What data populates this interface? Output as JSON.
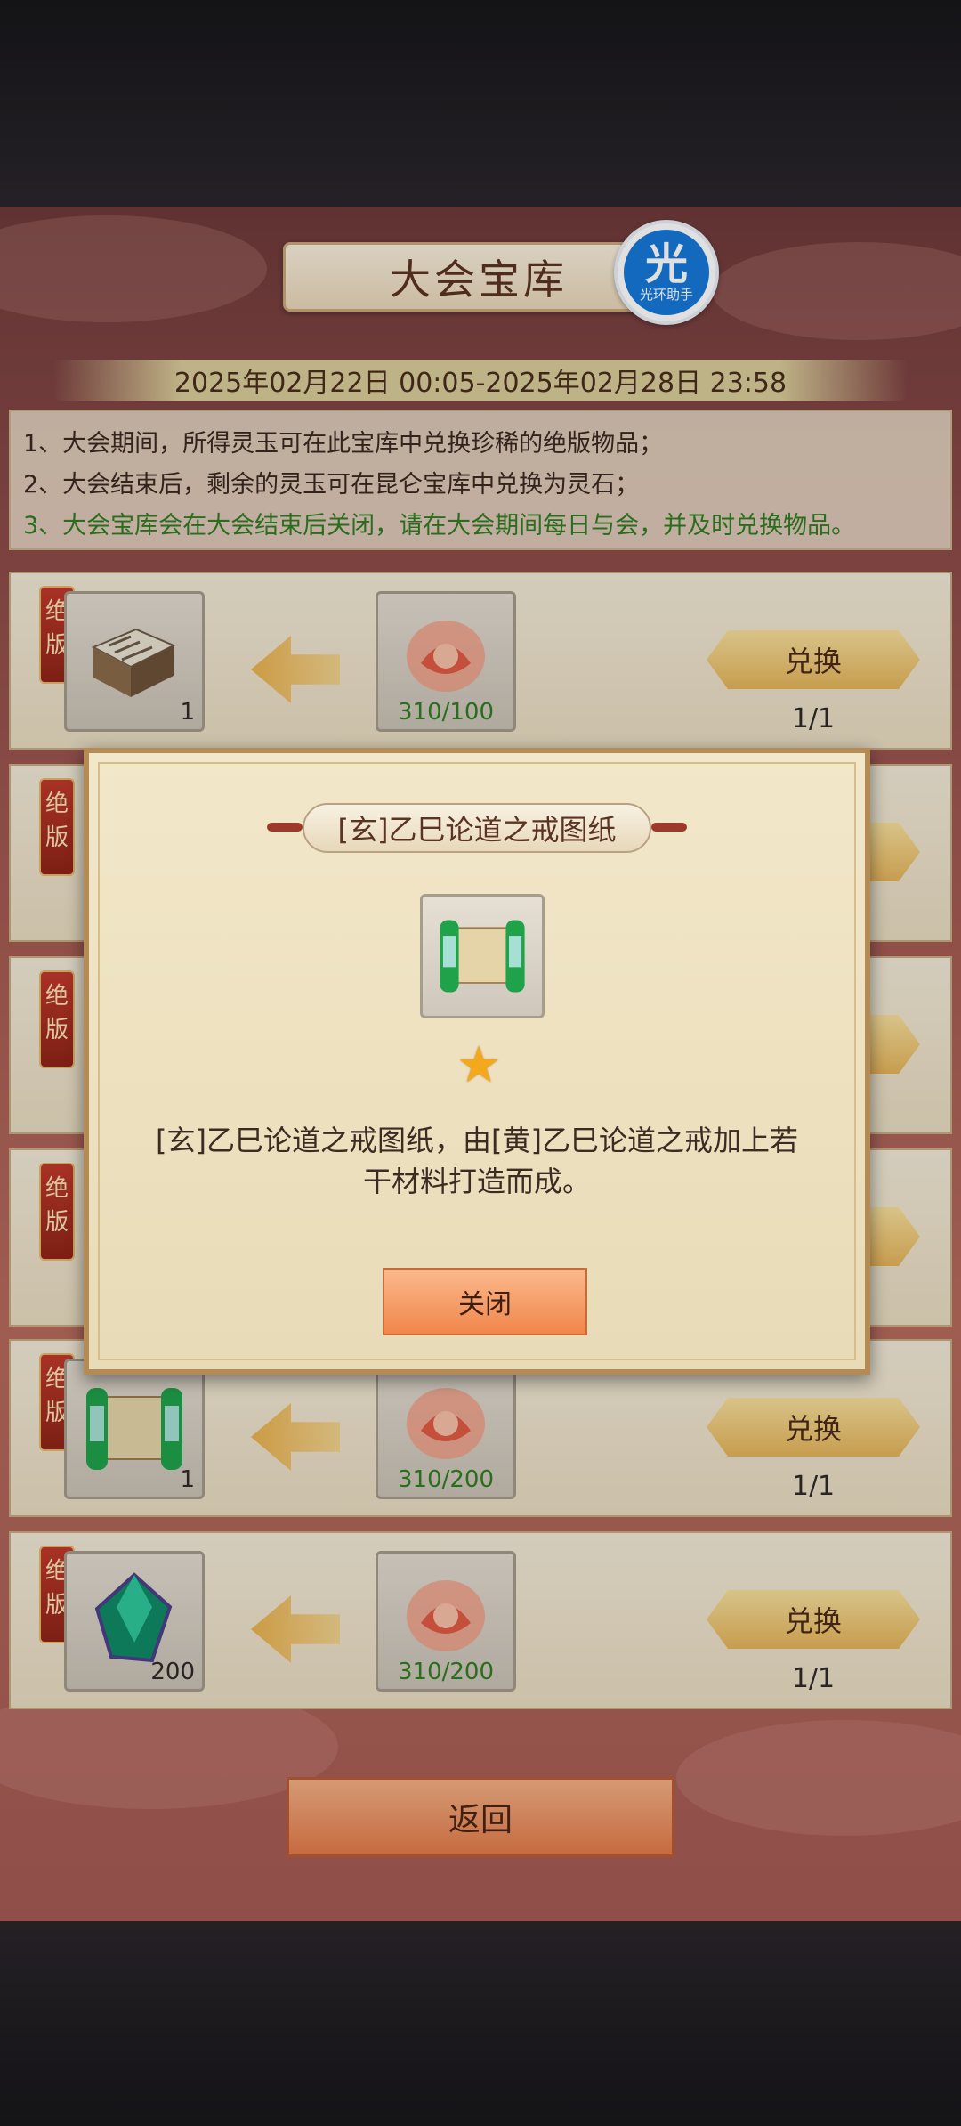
{
  "header": {
    "title": "大会宝库",
    "badge_glyph": "光",
    "badge_text": "光环助手"
  },
  "date_range": "2025年02月22日 00:05-2025年02月28日 23:58",
  "rules": [
    "1、大会期间，所得灵玉可在此宝库中兑换珍稀的绝版物品；",
    "2、大会结束后，剩余的灵玉可在昆仑宝库中兑换为灵石；",
    "3、大会宝库会在大会结束后关闭，请在大会期间每日与会，并及时兑换物品。"
  ],
  "tag_text": "绝版",
  "exchange_label": "兑换",
  "rows": [
    {
      "item_icon": "book-icon",
      "item_count": "1",
      "cost": "310/100",
      "limit": "1/1"
    },
    {
      "item_icon": "hidden-item",
      "item_count": "",
      "cost": "",
      "limit": ""
    },
    {
      "item_icon": "hidden-item",
      "item_count": "",
      "cost": "",
      "limit": ""
    },
    {
      "item_icon": "hidden-item",
      "item_count": "",
      "cost": "",
      "limit": ""
    },
    {
      "item_icon": "scroll-icon",
      "item_count": "1",
      "cost": "310/200",
      "limit": "1/1"
    },
    {
      "item_icon": "jade-gem-icon",
      "item_count": "200",
      "cost": "310/200",
      "limit": "1/1"
    }
  ],
  "back_label": "返回",
  "dialog": {
    "title": "[玄]乙巳论道之戒图纸",
    "item_icon": "scroll-icon",
    "rarity_icon": "star-icon",
    "description": "[玄]乙巳论道之戒图纸，由[黄]乙巳论道之戒加上若干材料打造而成。",
    "close_label": "关闭"
  },
  "colors": {
    "green_text": "#2f7d21",
    "accent_gold": "#e3b35a",
    "tag_red": "#c0392b"
  }
}
